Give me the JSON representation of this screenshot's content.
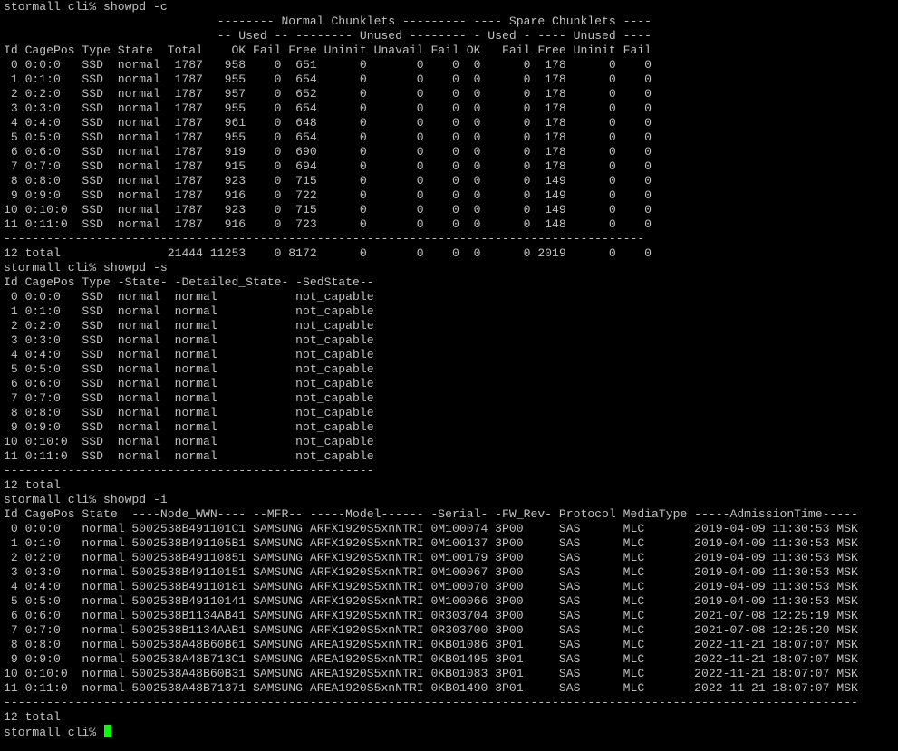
{
  "theme": {
    "background": "#000000",
    "foreground": "#c0c0c0",
    "cursor": "#00ff00"
  },
  "terminal": {
    "lines": [
      "stormall cli% showpd -c",
      "                              -------- Normal Chunklets --------- ---- Spare Chunklets ----",
      "                              -- Used -- -------- Unused -------- - Used - ---- Unused ----",
      "Id CagePos Type State  Total    OK Fail Free Uninit Unavail Fail OK   Fail Free Uninit Fail",
      " 0 0:0:0   SSD  normal  1787   958    0  651      0       0    0  0      0  178      0    0",
      " 1 0:1:0   SSD  normal  1787   955    0  654      0       0    0  0      0  178      0    0",
      " 2 0:2:0   SSD  normal  1787   957    0  652      0       0    0  0      0  178      0    0",
      " 3 0:3:0   SSD  normal  1787   955    0  654      0       0    0  0      0  178      0    0",
      " 4 0:4:0   SSD  normal  1787   961    0  648      0       0    0  0      0  178      0    0",
      " 5 0:5:0   SSD  normal  1787   955    0  654      0       0    0  0      0  178      0    0",
      " 6 0:6:0   SSD  normal  1787   919    0  690      0       0    0  0      0  178      0    0",
      " 7 0:7:0   SSD  normal  1787   915    0  694      0       0    0  0      0  178      0    0",
      " 8 0:8:0   SSD  normal  1787   923    0  715      0       0    0  0      0  149      0    0",
      " 9 0:9:0   SSD  normal  1787   916    0  722      0       0    0  0      0  149      0    0",
      "10 0:10:0  SSD  normal  1787   923    0  715      0       0    0  0      0  149      0    0",
      "11 0:11:0  SSD  normal  1787   916    0  723      0       0    0  0      0  148      0    0",
      "------------------------------------------------------------------------------------------",
      "12 total               21444 11253    0 8172      0       0    0  0      0 2019      0    0",
      "stormall cli% showpd -s",
      "Id CagePos Type -State- -Detailed_State- -SedState--",
      " 0 0:0:0   SSD  normal  normal           not_capable",
      " 1 0:1:0   SSD  normal  normal           not_capable",
      " 2 0:2:0   SSD  normal  normal           not_capable",
      " 3 0:3:0   SSD  normal  normal           not_capable",
      " 4 0:4:0   SSD  normal  normal           not_capable",
      " 5 0:5:0   SSD  normal  normal           not_capable",
      " 6 0:6:0   SSD  normal  normal           not_capable",
      " 7 0:7:0   SSD  normal  normal           not_capable",
      " 8 0:8:0   SSD  normal  normal           not_capable",
      " 9 0:9:0   SSD  normal  normal           not_capable",
      "10 0:10:0  SSD  normal  normal           not_capable",
      "11 0:11:0  SSD  normal  normal           not_capable",
      "----------------------------------------------------",
      "12 total",
      "stormall cli% showpd -i",
      "Id CagePos State  ----Node_WWN---- --MFR-- -----Model------ -Serial- -FW_Rev- Protocol MediaType -----AdmissionTime-----",
      " 0 0:0:0   normal 5002538B491101C1 SAMSUNG ARFX1920S5xnNTRI 0M100074 3P00     SAS      MLC       2019-04-09 11:30:53 MSK",
      " 1 0:1:0   normal 5002538B491105B1 SAMSUNG ARFX1920S5xnNTRI 0M100137 3P00     SAS      MLC       2019-04-09 11:30:53 MSK",
      " 2 0:2:0   normal 5002538B49110851 SAMSUNG ARFX1920S5xnNTRI 0M100179 3P00     SAS      MLC       2019-04-09 11:30:53 MSK",
      " 3 0:3:0   normal 5002538B49110151 SAMSUNG ARFX1920S5xnNTRI 0M100067 3P00     SAS      MLC       2019-04-09 11:30:53 MSK",
      " 4 0:4:0   normal 5002538B49110181 SAMSUNG ARFX1920S5xnNTRI 0M100070 3P00     SAS      MLC       2019-04-09 11:30:53 MSK",
      " 5 0:5:0   normal 5002538B49110141 SAMSUNG ARFX1920S5xnNTRI 0M100066 3P00     SAS      MLC       2019-04-09 11:30:53 MSK",
      " 6 0:6:0   normal 5002538B1134AB41 SAMSUNG ARFX1920S5xnNTRI 0R303704 3P00     SAS      MLC       2021-07-08 12:25:19 MSK",
      " 7 0:7:0   normal 5002538B1134AAB1 SAMSUNG ARFX1920S5xnNTRI 0R303700 3P00     SAS      MLC       2021-07-08 12:25:20 MSK",
      " 8 0:8:0   normal 5002538A48B60B61 SAMSUNG AREA1920S5xnNTRI 0KB01086 3P01     SAS      MLC       2022-11-21 18:07:07 MSK",
      " 9 0:9:0   normal 5002538A48B713C1 SAMSUNG AREA1920S5xnNTRI 0KB01495 3P01     SAS      MLC       2022-11-21 18:07:07 MSK",
      "10 0:10:0  normal 5002538A48B60B31 SAMSUNG AREA1920S5xnNTRI 0KB01083 3P01     SAS      MLC       2022-11-21 18:07:07 MSK",
      "11 0:11:0  normal 5002538A48B71371 SAMSUNG AREA1920S5xnNTRI 0KB01490 3P01     SAS      MLC       2022-11-21 18:07:07 MSK",
      "------------------------------------------------------------------------------------------------------------------------",
      "12 total"
    ],
    "prompt": "stormall cli% "
  }
}
